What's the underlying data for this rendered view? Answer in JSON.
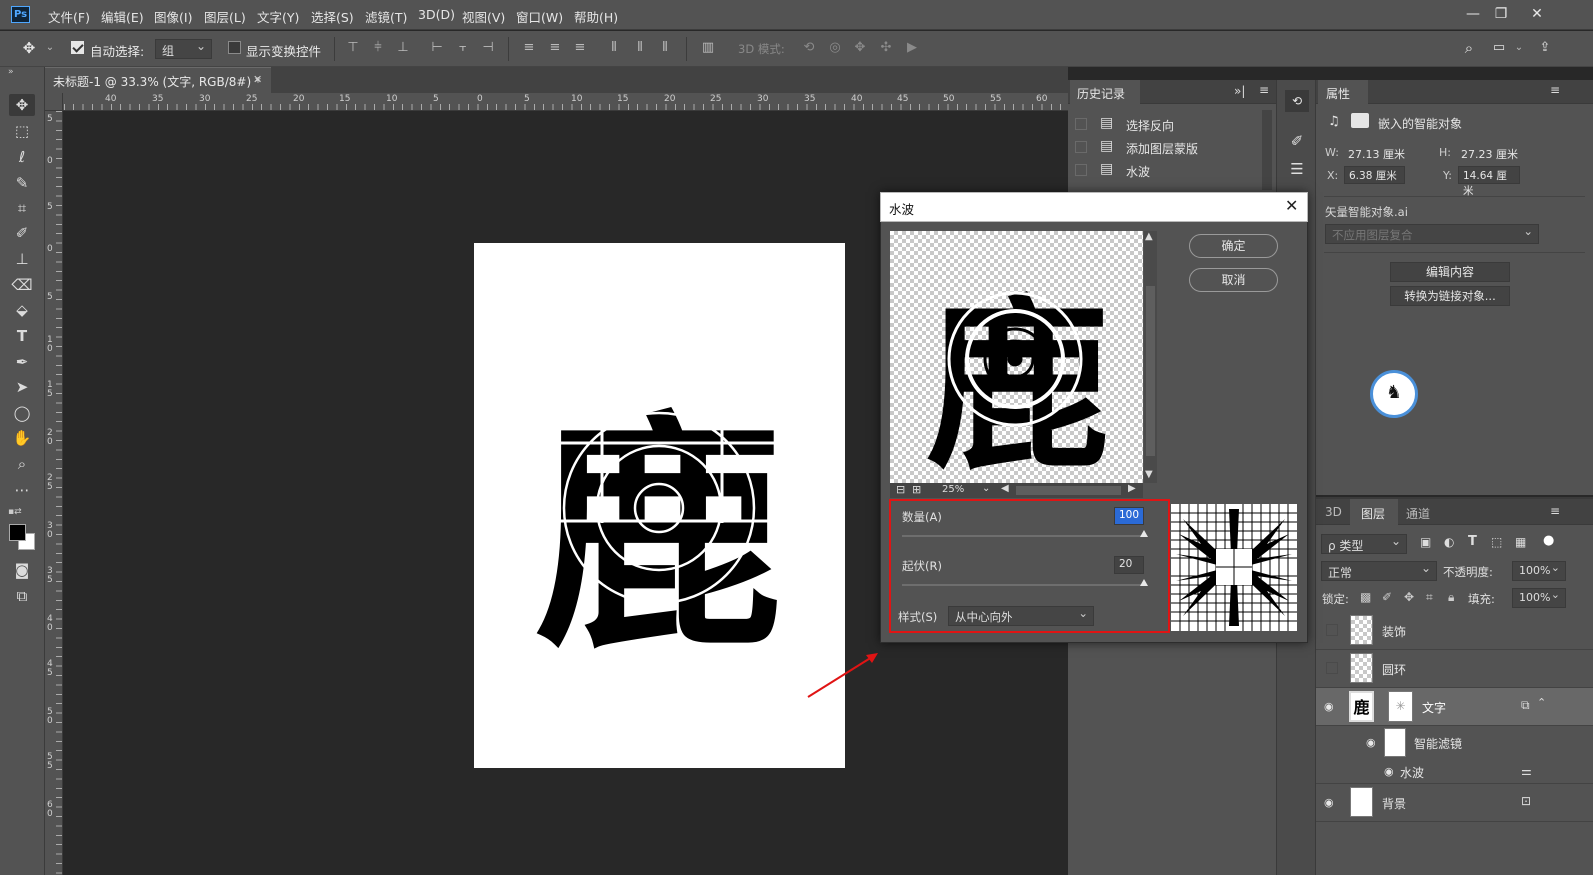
{
  "menubar": {
    "app_logo": "Ps",
    "items": [
      "文件(F)",
      "编辑(E)",
      "图像(I)",
      "图层(L)",
      "文字(Y)",
      "选择(S)",
      "滤镜(T)",
      "3D(D)",
      "视图(V)",
      "窗口(W)",
      "帮助(H)"
    ],
    "window_buttons": [
      "—",
      "❐",
      "✕"
    ]
  },
  "options_bar": {
    "auto_select_label": "自动选择:",
    "auto_select_value": "组",
    "show_transform_label": "显示变换控件",
    "mode_3d_label": "3D 模式:"
  },
  "document": {
    "tab_title": "未标题-1 @ 33.3% (文字, RGB/8#) *",
    "glyph": "鹿"
  },
  "ruler": {
    "h_labels": [
      "40",
      "35",
      "30",
      "25",
      "20",
      "15",
      "10",
      "5",
      "0",
      "5",
      "10",
      "15",
      "20",
      "25",
      "30",
      "35",
      "40",
      "45",
      "50",
      "55",
      "60"
    ],
    "v_labels": [
      "5",
      "0",
      "5",
      "0",
      "5",
      "1\n0",
      "1\n5",
      "2\n0",
      "2\n5",
      "3\n0",
      "3\n5",
      "4\n0",
      "4\n5",
      "5\n0",
      "5\n5",
      "6\n0"
    ]
  },
  "history": {
    "tab": "历史记录",
    "items": [
      "选择反向",
      "添加图层蒙版",
      "水波"
    ]
  },
  "dialog": {
    "title": "水波",
    "ok": "确定",
    "cancel": "取消",
    "zoom": "25%",
    "amount_label": "数量(A)",
    "amount_value": "100",
    "ridges_label": "起伏(R)",
    "ridges_value": "20",
    "style_label": "样式(S)",
    "style_value": "从中心向外"
  },
  "properties": {
    "tab": "属性",
    "object_type": "嵌入的智能对象",
    "w_label": "W:",
    "w_value": "27.13 厘米",
    "h_label": "H:",
    "h_value": "27.23 厘米",
    "x_label": "X:",
    "x_value": "6.38 厘米",
    "y_label": "Y:",
    "y_value": "14.64 厘米",
    "source_file": "矢量智能对象.ai",
    "comp_placeholder": "不应用图层复合",
    "edit_btn": "编辑内容",
    "convert_btn": "转换为链接对象..."
  },
  "layers": {
    "tabs": [
      "3D",
      "图层",
      "通道"
    ],
    "filter_label": "ρ 类型",
    "blend_mode": "正常",
    "opacity_label": "不透明度:",
    "opacity_value": "100%",
    "lock_label": "锁定:",
    "fill_label": "填充:",
    "fill_value": "100%",
    "rows": [
      "装饰",
      "圆环",
      "文字",
      "智能滤镜",
      "水波",
      "背景"
    ]
  },
  "colors": {
    "menubar_bg": "#535353",
    "canvas_bg": "#282828",
    "highlight_red": "#e01414",
    "field_blue": "#2b6ad6"
  }
}
